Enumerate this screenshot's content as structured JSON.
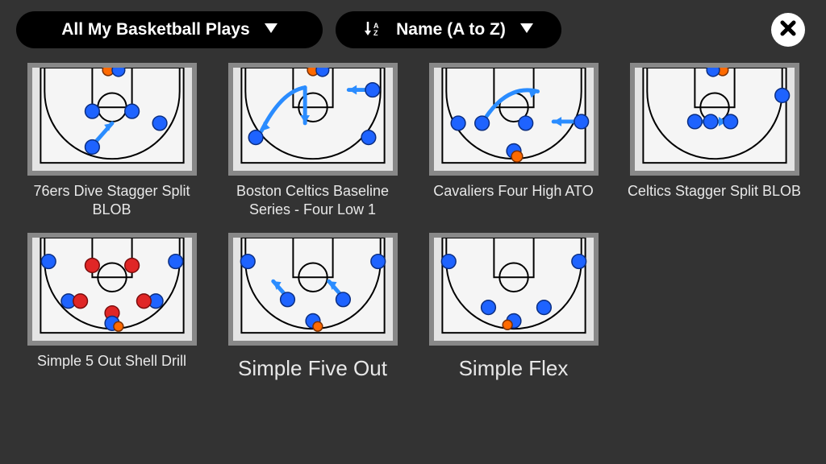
{
  "filter": {
    "label": "All My Basketball Plays"
  },
  "sort": {
    "label": "Name (A to Z)"
  },
  "plays": [
    {
      "title": "76ers Dive Stagger Split BLOB",
      "big": false
    },
    {
      "title": "Boston Celtics Baseline Series - Four Low 1",
      "big": false
    },
    {
      "title": "Cavaliers Four High ATO",
      "big": false
    },
    {
      "title": "Celtics Stagger Split BLOB",
      "big": false
    },
    {
      "title": "Simple 5 Out Shell Drill",
      "big": false
    },
    {
      "title": "Simple Five Out",
      "big": true
    },
    {
      "title": "Simple Flex",
      "big": true
    }
  ]
}
